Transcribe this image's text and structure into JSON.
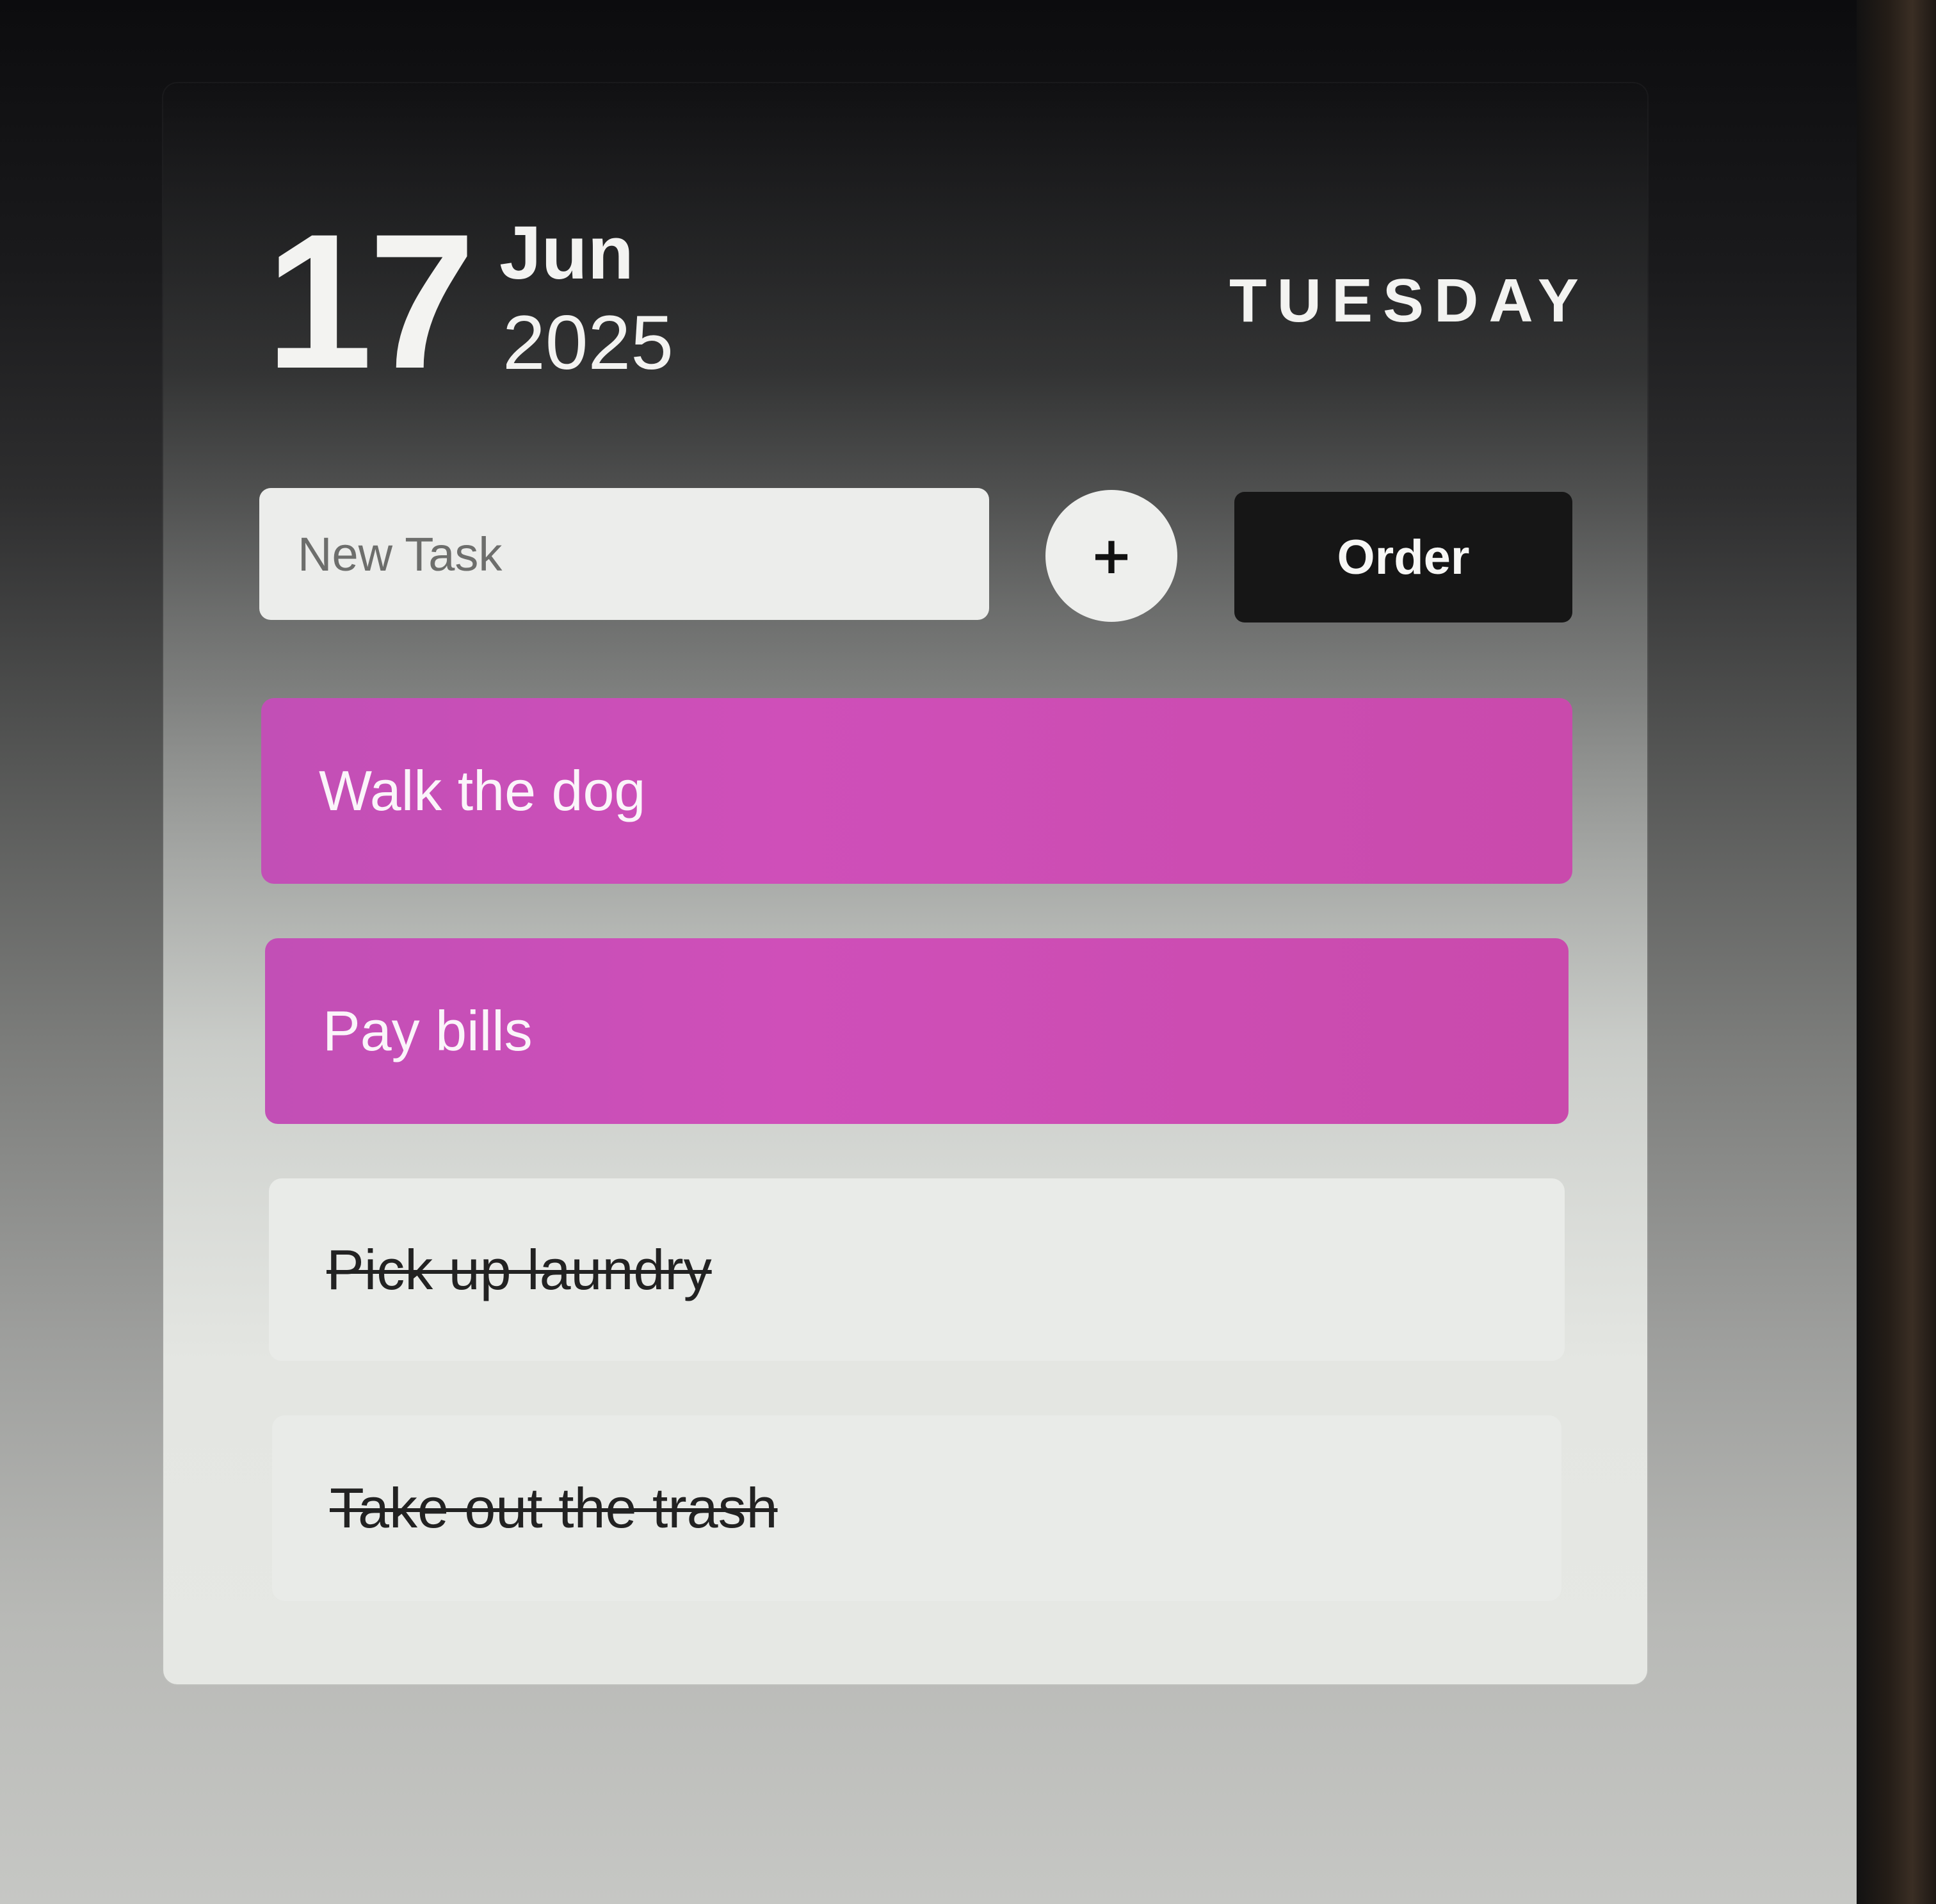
{
  "header": {
    "day": "17",
    "month": "Jun",
    "year": "2025",
    "weekday": "TUESDAY"
  },
  "new_task": {
    "placeholder": "New Task",
    "value": ""
  },
  "toolbar": {
    "add_label": "+",
    "order_label": "Order"
  },
  "tasks": [
    {
      "label": "Walk the dog",
      "done": false
    },
    {
      "label": "Pay bills",
      "done": false
    },
    {
      "label": "Pick up laundry",
      "done": true
    },
    {
      "label": "Take out the trash",
      "done": true
    }
  ],
  "colors": {
    "pending_task": "#c94fb6",
    "done_task": "#e9ebe8",
    "order_button": "#161616"
  }
}
